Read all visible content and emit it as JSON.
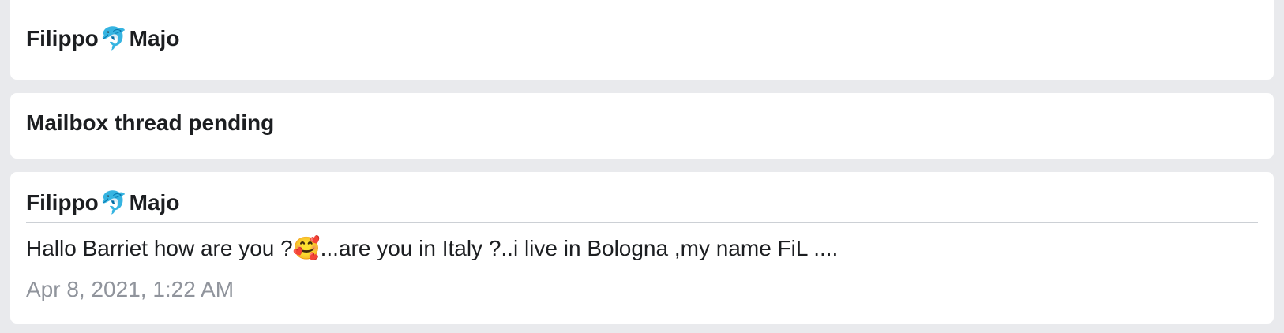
{
  "conversation": {
    "header": {
      "name_first": "Filippo",
      "name_emoji": "🐬",
      "name_last": "Majo"
    },
    "status": {
      "label": "Mailbox thread pending"
    },
    "message": {
      "sender_first": "Filippo",
      "sender_emoji": "🐬",
      "sender_last": "Majo",
      "text_before_emoji": "Hallo Barriet how are you ?",
      "text_emoji": "🥰",
      "text_after_emoji": "...are you in Italy ?..i live in Bologna ,my name FiL ....",
      "timestamp": "Apr 8, 2021, 1:22 AM"
    }
  }
}
